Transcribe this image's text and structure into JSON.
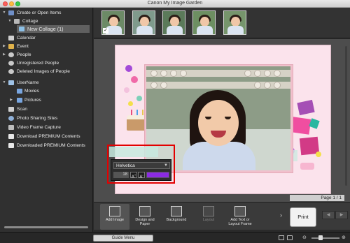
{
  "window": {
    "title": "Canon My Image Garden"
  },
  "sidebar": {
    "items": [
      {
        "label": "Create or Open Items",
        "icon": "folder-icon"
      },
      {
        "label": "Collage",
        "icon": "collage-icon"
      },
      {
        "label": "New Collage (1)",
        "icon": "collage-item-icon",
        "selected": true
      },
      {
        "label": "Calendar",
        "icon": "calendar-icon"
      },
      {
        "label": "Event",
        "icon": "event-icon"
      },
      {
        "label": "People",
        "icon": "people-icon"
      },
      {
        "label": "Unregistered People",
        "icon": "person-unknown-icon"
      },
      {
        "label": "Deleted Images of People",
        "icon": "person-deleted-icon"
      },
      {
        "label": "UserName",
        "icon": "computer-icon"
      },
      {
        "label": "Movies",
        "icon": "folder-icon"
      },
      {
        "label": "Pictures",
        "icon": "folder-icon"
      },
      {
        "label": "Scan",
        "icon": "scan-icon"
      },
      {
        "label": "Photo Sharing Sites",
        "icon": "globe-icon"
      },
      {
        "label": "Video Frame Capture",
        "icon": "film-icon"
      },
      {
        "label": "Download PREMIUM Contents",
        "icon": "download-icon"
      },
      {
        "label": "Downloaded PREMIUM Contents",
        "icon": "downloaded-icon"
      }
    ]
  },
  "text_panel": {
    "font": "Helvetica",
    "size": "18"
  },
  "canvas": {
    "page_indicator": "Page 1 / 1"
  },
  "toolbar": {
    "add_image": "Add Image",
    "design_and_paper": "Design and Paper",
    "background": "Background",
    "layout": "Layout",
    "add_text": "Add Text or Layout Frame",
    "print": "Print"
  },
  "statusbar": {
    "guide_menu": "Guide Menu"
  },
  "colors": {
    "text_color_swatch": "#8b2be2",
    "highlight": "#e30000"
  }
}
